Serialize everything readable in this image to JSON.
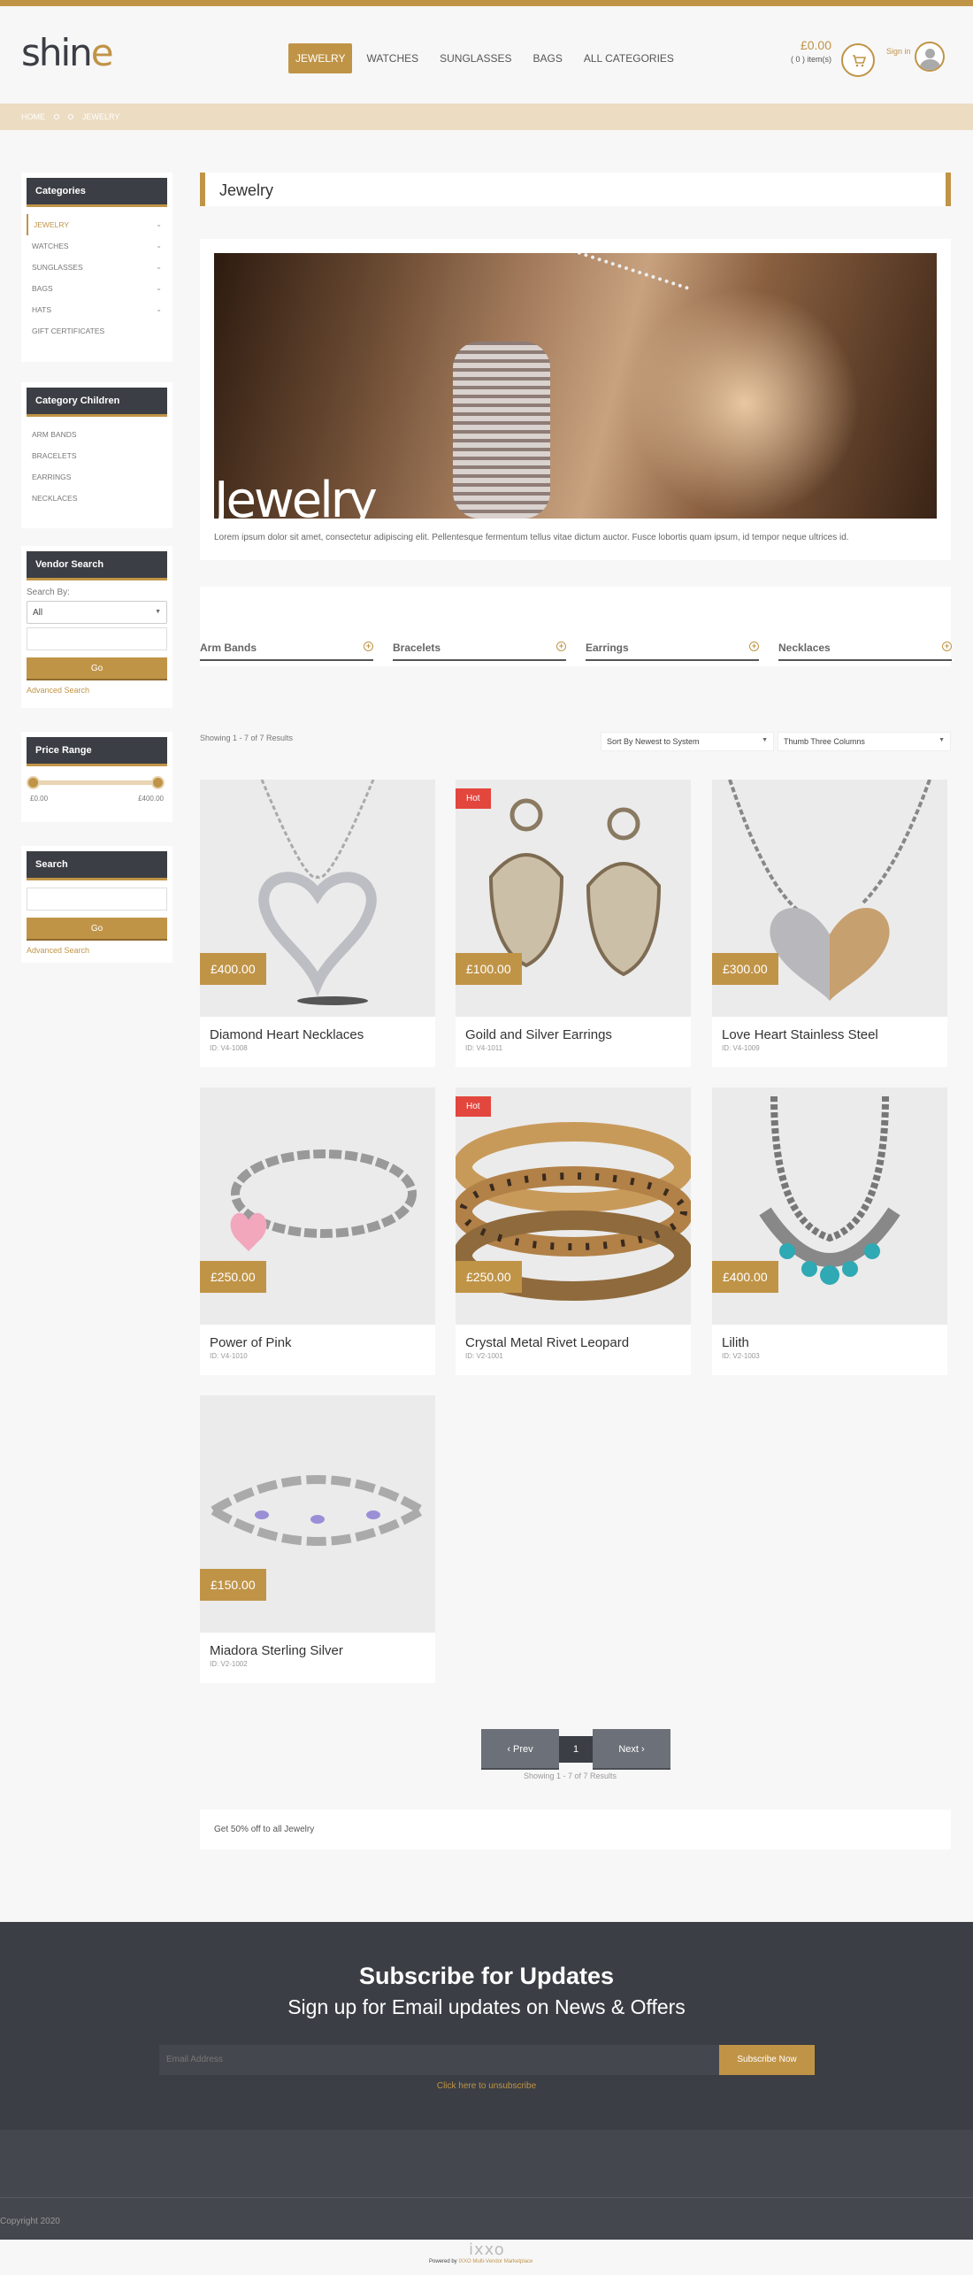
{
  "logo": {
    "text_main": "shin",
    "text_accent": "e"
  },
  "nav": {
    "items": [
      {
        "label": "JEWELRY",
        "active": true
      },
      {
        "label": "WATCHES"
      },
      {
        "label": "SUNGLASSES"
      },
      {
        "label": "BAGS"
      },
      {
        "label": "ALL CATEGORIES"
      }
    ]
  },
  "cart": {
    "total": "£0.00",
    "items": "( 0 ) item(s)",
    "icon": "cart-icon"
  },
  "signin": {
    "label": "Sign in",
    "icon": "user-avatar-icon"
  },
  "breadcrumb": {
    "home": "HOME",
    "current": "JEWELRY"
  },
  "sidebar": {
    "categories": {
      "title": "Categories",
      "items": [
        {
          "label": "JEWELRY",
          "active": true,
          "expandable": true
        },
        {
          "label": "WATCHES",
          "expandable": true
        },
        {
          "label": "SUNGLASSES",
          "expandable": true
        },
        {
          "label": "BAGS",
          "expandable": true
        },
        {
          "label": "HATS",
          "expandable": true
        },
        {
          "label": "GIFT CERTIFICATES"
        }
      ]
    },
    "children": {
      "title": "Category Children",
      "items": [
        "ARM BANDS",
        "BRACELETS",
        "EARRINGS",
        "NECKLACES"
      ]
    },
    "vendor": {
      "title": "Vendor Search",
      "search_by": "Search By:",
      "select_value": "All",
      "go": "Go",
      "advanced": "Advanced Search"
    },
    "price": {
      "title": "Price Range",
      "min": "£0.00",
      "max": "£400.00"
    },
    "search": {
      "title": "Search",
      "go": "Go",
      "advanced": "Advanced Search"
    }
  },
  "main": {
    "title": "Jewelry",
    "hero_text": "Jewelry",
    "hero_desc": "Lorem ipsum dolor sit amet, consectetur adipiscing elit. Pellentesque fermentum tellus vitae dictum auctor. Fusce lobortis quam ipsum, id tempor neque ultrices id.",
    "subcats": [
      "Arm Bands",
      "Bracelets",
      "Earrings",
      "Necklaces"
    ],
    "showing": "Showing 1 - 7 of 7 Results",
    "sort": "Sort By Newest to System",
    "layout": "Thumb Three Columns",
    "products": [
      {
        "name": "Diamond Heart Necklaces",
        "id": "ID: V4-1008",
        "price": "£400.00"
      },
      {
        "name": "Goild and Silver Earrings",
        "id": "ID: V4-1011",
        "price": "£100.00",
        "badge": "Hot"
      },
      {
        "name": "Love Heart Stainless Steel",
        "id": "ID: V4-1009",
        "price": "£300.00"
      },
      {
        "name": "Power of Pink",
        "id": "ID: V4-1010",
        "price": "£250.00"
      },
      {
        "name": "Crystal Metal Rivet Leopard",
        "id": "ID: V2-1001",
        "price": "£250.00",
        "badge": "Hot"
      },
      {
        "name": "Lilith",
        "id": "ID: V2-1003",
        "price": "£400.00"
      },
      {
        "name": "Miadora Sterling Silver",
        "id": "ID: V2-1002",
        "price": "£150.00"
      }
    ],
    "pager": {
      "prev": "‹ Prev",
      "page": "1",
      "next": "Next ›",
      "showing": "Showing 1 - 7 of 7 Results"
    },
    "promo": "Get 50% off to all Jewelry"
  },
  "subscribe": {
    "title": "Subscribe for Updates",
    "subtitle": "Sign up for Email updates on News & Offers",
    "placeholder": "Email Address",
    "button": "Subscribe Now",
    "unsubscribe": "Click here to unsubscribe"
  },
  "footer": {
    "copyright": "Copyright 2020",
    "logo": "ixxo",
    "powered": "Powered by",
    "brand": "IXXO Multi-Vendor Marketplace"
  },
  "colors": {
    "accent": "#c09447",
    "dark": "#3b3e44",
    "hot": "#e3463d"
  }
}
